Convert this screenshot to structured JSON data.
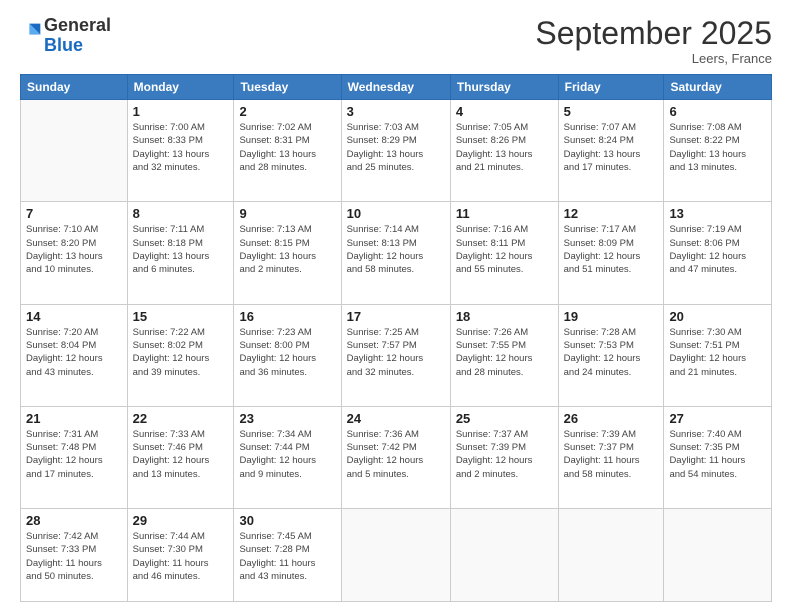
{
  "logo": {
    "general": "General",
    "blue": "Blue"
  },
  "title": "September 2025",
  "subtitle": "Leers, France",
  "days_header": [
    "Sunday",
    "Monday",
    "Tuesday",
    "Wednesday",
    "Thursday",
    "Friday",
    "Saturday"
  ],
  "weeks": [
    [
      {
        "day": "",
        "info": ""
      },
      {
        "day": "1",
        "info": "Sunrise: 7:00 AM\nSunset: 8:33 PM\nDaylight: 13 hours\nand 32 minutes."
      },
      {
        "day": "2",
        "info": "Sunrise: 7:02 AM\nSunset: 8:31 PM\nDaylight: 13 hours\nand 28 minutes."
      },
      {
        "day": "3",
        "info": "Sunrise: 7:03 AM\nSunset: 8:29 PM\nDaylight: 13 hours\nand 25 minutes."
      },
      {
        "day": "4",
        "info": "Sunrise: 7:05 AM\nSunset: 8:26 PM\nDaylight: 13 hours\nand 21 minutes."
      },
      {
        "day": "5",
        "info": "Sunrise: 7:07 AM\nSunset: 8:24 PM\nDaylight: 13 hours\nand 17 minutes."
      },
      {
        "day": "6",
        "info": "Sunrise: 7:08 AM\nSunset: 8:22 PM\nDaylight: 13 hours\nand 13 minutes."
      }
    ],
    [
      {
        "day": "7",
        "info": "Sunrise: 7:10 AM\nSunset: 8:20 PM\nDaylight: 13 hours\nand 10 minutes."
      },
      {
        "day": "8",
        "info": "Sunrise: 7:11 AM\nSunset: 8:18 PM\nDaylight: 13 hours\nand 6 minutes."
      },
      {
        "day": "9",
        "info": "Sunrise: 7:13 AM\nSunset: 8:15 PM\nDaylight: 13 hours\nand 2 minutes."
      },
      {
        "day": "10",
        "info": "Sunrise: 7:14 AM\nSunset: 8:13 PM\nDaylight: 12 hours\nand 58 minutes."
      },
      {
        "day": "11",
        "info": "Sunrise: 7:16 AM\nSunset: 8:11 PM\nDaylight: 12 hours\nand 55 minutes."
      },
      {
        "day": "12",
        "info": "Sunrise: 7:17 AM\nSunset: 8:09 PM\nDaylight: 12 hours\nand 51 minutes."
      },
      {
        "day": "13",
        "info": "Sunrise: 7:19 AM\nSunset: 8:06 PM\nDaylight: 12 hours\nand 47 minutes."
      }
    ],
    [
      {
        "day": "14",
        "info": "Sunrise: 7:20 AM\nSunset: 8:04 PM\nDaylight: 12 hours\nand 43 minutes."
      },
      {
        "day": "15",
        "info": "Sunrise: 7:22 AM\nSunset: 8:02 PM\nDaylight: 12 hours\nand 39 minutes."
      },
      {
        "day": "16",
        "info": "Sunrise: 7:23 AM\nSunset: 8:00 PM\nDaylight: 12 hours\nand 36 minutes."
      },
      {
        "day": "17",
        "info": "Sunrise: 7:25 AM\nSunset: 7:57 PM\nDaylight: 12 hours\nand 32 minutes."
      },
      {
        "day": "18",
        "info": "Sunrise: 7:26 AM\nSunset: 7:55 PM\nDaylight: 12 hours\nand 28 minutes."
      },
      {
        "day": "19",
        "info": "Sunrise: 7:28 AM\nSunset: 7:53 PM\nDaylight: 12 hours\nand 24 minutes."
      },
      {
        "day": "20",
        "info": "Sunrise: 7:30 AM\nSunset: 7:51 PM\nDaylight: 12 hours\nand 21 minutes."
      }
    ],
    [
      {
        "day": "21",
        "info": "Sunrise: 7:31 AM\nSunset: 7:48 PM\nDaylight: 12 hours\nand 17 minutes."
      },
      {
        "day": "22",
        "info": "Sunrise: 7:33 AM\nSunset: 7:46 PM\nDaylight: 12 hours\nand 13 minutes."
      },
      {
        "day": "23",
        "info": "Sunrise: 7:34 AM\nSunset: 7:44 PM\nDaylight: 12 hours\nand 9 minutes."
      },
      {
        "day": "24",
        "info": "Sunrise: 7:36 AM\nSunset: 7:42 PM\nDaylight: 12 hours\nand 5 minutes."
      },
      {
        "day": "25",
        "info": "Sunrise: 7:37 AM\nSunset: 7:39 PM\nDaylight: 12 hours\nand 2 minutes."
      },
      {
        "day": "26",
        "info": "Sunrise: 7:39 AM\nSunset: 7:37 PM\nDaylight: 11 hours\nand 58 minutes."
      },
      {
        "day": "27",
        "info": "Sunrise: 7:40 AM\nSunset: 7:35 PM\nDaylight: 11 hours\nand 54 minutes."
      }
    ],
    [
      {
        "day": "28",
        "info": "Sunrise: 7:42 AM\nSunset: 7:33 PM\nDaylight: 11 hours\nand 50 minutes."
      },
      {
        "day": "29",
        "info": "Sunrise: 7:44 AM\nSunset: 7:30 PM\nDaylight: 11 hours\nand 46 minutes."
      },
      {
        "day": "30",
        "info": "Sunrise: 7:45 AM\nSunset: 7:28 PM\nDaylight: 11 hours\nand 43 minutes."
      },
      {
        "day": "",
        "info": ""
      },
      {
        "day": "",
        "info": ""
      },
      {
        "day": "",
        "info": ""
      },
      {
        "day": "",
        "info": ""
      }
    ]
  ]
}
